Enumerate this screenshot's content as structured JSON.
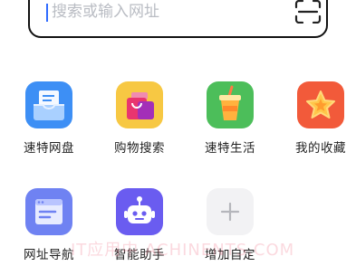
{
  "search": {
    "placeholder": "搜索或输入网址",
    "scan_icon": "scan-icon"
  },
  "shortcuts": [
    {
      "label": "速特网盘",
      "icon": "cloud-drive-icon",
      "color": "#3d8ff5"
    },
    {
      "label": "购物搜索",
      "icon": "shopping-bag-icon",
      "color": "#f7c843"
    },
    {
      "label": "速特生活",
      "icon": "drink-cup-icon",
      "color": "#4cbe5a"
    },
    {
      "label": "我的收藏",
      "icon": "star-icon",
      "color": "#f25a3a"
    },
    {
      "label": "网址导航",
      "icon": "browser-window-icon",
      "color": "#6f82f2"
    },
    {
      "label": "智能助手",
      "icon": "robot-icon",
      "color": "#6a5cf0"
    },
    {
      "label": "增加自定",
      "icon": "add-icon",
      "color": "#f2f2f4"
    }
  ],
  "watermark": "IT应用中 ACHINENTS.COM"
}
